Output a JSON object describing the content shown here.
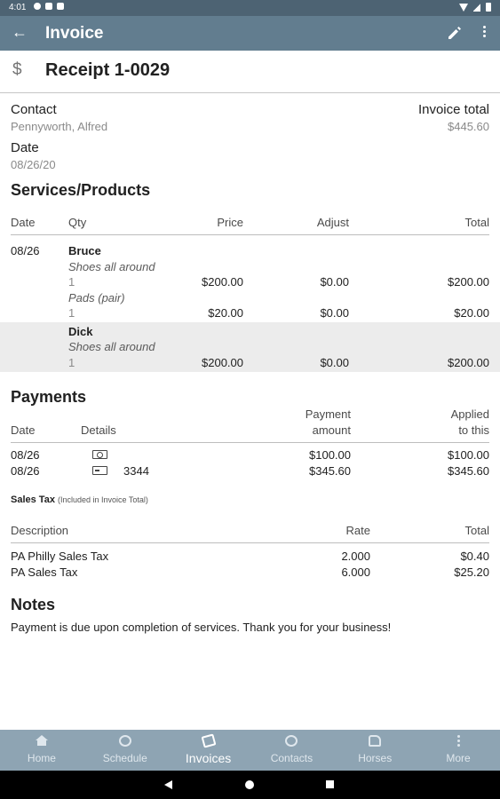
{
  "status_bar": {
    "time": "4:01"
  },
  "app_bar": {
    "title": "Invoice"
  },
  "receipt": {
    "title": "Receipt 1-0029",
    "icon": "dollar-icon",
    "icon_glyph": "$"
  },
  "contact": {
    "label": "Contact",
    "value": "Pennyworth, Alfred"
  },
  "invoice_total": {
    "label": "Invoice total",
    "value": "$445.60"
  },
  "date": {
    "label": "Date",
    "value": "08/26/20"
  },
  "services": {
    "heading": "Services/Products",
    "columns": {
      "date": "Date",
      "qty": "Qty",
      "price": "Price",
      "adjust": "Adjust",
      "total": "Total"
    },
    "groups": [
      {
        "date": "08/26",
        "horse": "Bruce",
        "items": [
          {
            "name": "Shoes all around",
            "qty": "1",
            "price": "$200.00",
            "adjust": "$0.00",
            "total": "$200.00"
          },
          {
            "name": "Pads (pair)",
            "qty": "1",
            "price": "$20.00",
            "adjust": "$0.00",
            "total": "$20.00"
          }
        ]
      },
      {
        "date": "",
        "horse": "Dick",
        "items": [
          {
            "name": "Shoes all around",
            "qty": "1",
            "price": "$200.00",
            "adjust": "$0.00",
            "total": "$200.00"
          }
        ]
      }
    ]
  },
  "payments": {
    "heading": "Payments",
    "columns": {
      "date": "Date",
      "details": "Details",
      "amount_line1": "Payment",
      "amount_line2": "amount",
      "applied_line1": "Applied",
      "applied_line2": "to this"
    },
    "rows": [
      {
        "date": "08/26",
        "icon": "cash-icon",
        "details": "",
        "amount": "$100.00",
        "applied": "$100.00"
      },
      {
        "date": "08/26",
        "icon": "card-icon",
        "details": "3344",
        "amount": "$345.60",
        "applied": "$345.60"
      }
    ]
  },
  "sales_tax": {
    "heading": "Sales Tax",
    "note": "(Included in Invoice Total)",
    "columns": {
      "description": "Description",
      "rate": "Rate",
      "total": "Total"
    },
    "rows": [
      {
        "description": "PA Philly Sales Tax",
        "rate": "2.000",
        "total": "$0.40"
      },
      {
        "description": "PA Sales Tax",
        "rate": "6.000",
        "total": "$25.20"
      }
    ]
  },
  "notes": {
    "heading": "Notes",
    "text": "Payment is due upon completion of services. Thank you for your business!"
  },
  "bottom_nav": [
    {
      "label": "Home",
      "icon": "home-icon",
      "active": false
    },
    {
      "label": "Schedule",
      "icon": "clock-icon",
      "active": false
    },
    {
      "label": "Invoices",
      "icon": "invoices-icon",
      "active": true
    },
    {
      "label": "Contacts",
      "icon": "contacts-icon",
      "active": false
    },
    {
      "label": "Horses",
      "icon": "horse-icon",
      "active": false
    },
    {
      "label": "More",
      "icon": "more-icon",
      "active": false
    }
  ],
  "colors": {
    "app_bar": "#627d8f",
    "status_bar": "#4d6373",
    "bottom_nav": "#8ea4b3",
    "row_shade": "#ececec"
  }
}
